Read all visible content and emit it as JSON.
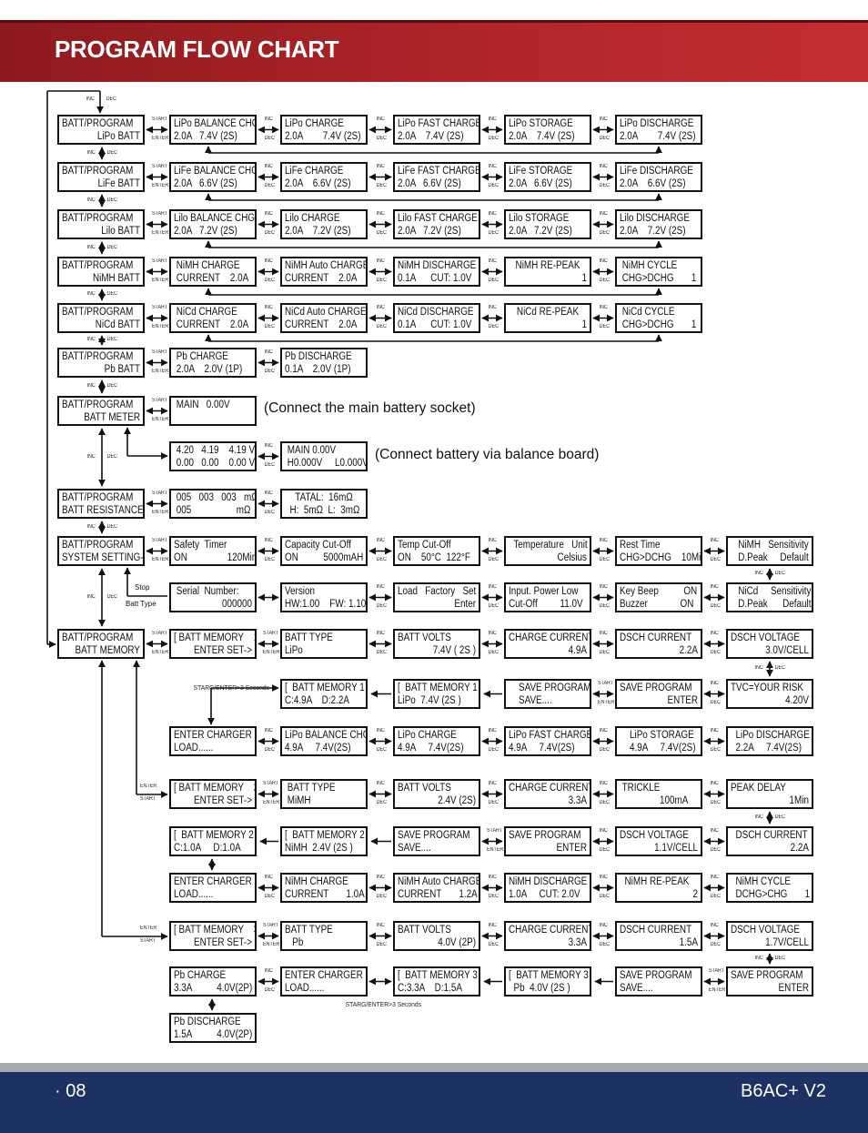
{
  "header": {
    "title": "PROGRAM FLOW CHART"
  },
  "footer": {
    "page": "· 08",
    "model": "B6AC+ V2"
  },
  "labels": {
    "inc": "INC",
    "dec": "DEC",
    "start": "START",
    "enter": "ENTER",
    "stop": "Stop",
    "batt_type": "Batt Type",
    "starg": "STARG/ENTER>3 Seconds"
  },
  "notes": {
    "main_socket": "(Connect the main battery socket)",
    "balance_board": "(Connect battery via balance board)"
  },
  "rows": [
    [
      {
        "l1": "BATT/PROGRAM",
        "l2": "LiPo BATT"
      },
      {
        "l1": "LiPo BALANCE CHG",
        "l2": "2.0A   7.4V (2S)"
      },
      {
        "l1": "LiPo CHARGE",
        "l2": "2.0A        7.4V (2S)"
      },
      {
        "l1": "LiPo FAST CHARGE",
        "l2": "2.0A    7.4V (2S)"
      },
      {
        "l1": "LiPo STORAGE",
        "l2": "2.0A    7.4V (2S)"
      },
      {
        "l1": "LiPo DISCHARGE",
        "l2": "2.0A        7.4V (2S)"
      }
    ],
    [
      {
        "l1": "BATT/PROGRAM",
        "l2": "LiFe BATT"
      },
      {
        "l1": "LiFe BALANCE CHG",
        "l2": "2.0A   6.6V (2S)"
      },
      {
        "l1": "LiFe CHARGE",
        "l2": "2.0A    6.6V (2S)"
      },
      {
        "l1": "LiFe FAST CHARGE",
        "l2": "2.0A   6.6V (2S)"
      },
      {
        "l1": "LiFe STORAGE",
        "l2": "2.0A   6.6V (2S)"
      },
      {
        "l1": "LiFe DISCHARGE",
        "l2": "2.0A    6.6V (2S)"
      }
    ],
    [
      {
        "l1": "BATT/PROGRAM",
        "l2": "Lilo BATT"
      },
      {
        "l1": "Lilo BALANCE CHG",
        "l2": "2.0A   7.2V (2S)"
      },
      {
        "l1": "Lilo CHARGE",
        "l2": "2.0A    7.2V (2S)"
      },
      {
        "l1": "Lilo FAST CHARGE",
        "l2": "2.0A   7.2V (2S)"
      },
      {
        "l1": "Lilo STORAGE",
        "l2": "2.0A   7.2V (2S)"
      },
      {
        "l1": "Lilo DISCHARGE",
        "l2": "2.0A    7.2V (2S)"
      }
    ],
    [
      {
        "l1": "BATT/PROGRAM",
        "l2": "NiMH BATT"
      },
      {
        "l1": " NiMH CHARGE",
        "l2": " CURRENT    2.0A"
      },
      {
        "l1": "NiMH Auto CHARGE",
        "l2": "CURRENT    2.0A"
      },
      {
        "l1": "NiMH DISCHARGE",
        "l2": "0.1A      CUT: 1.0V"
      },
      {
        "l1": "NiMH RE-PEAK",
        "l2": "1"
      },
      {
        "l1": " NiMH CYCLE",
        "l2": " CHG>DCHG       1"
      }
    ],
    [
      {
        "l1": "BATT/PROGRAM",
        "l2": "NiCd BATT"
      },
      {
        "l1": " NiCd CHARGE",
        "l2": " CURRENT    2.0A"
      },
      {
        "l1": "NiCd Auto CHARGE",
        "l2": "CURRENT    2.0A"
      },
      {
        "l1": "NiCd DISCHARGE",
        "l2": "0.1A      CUT: 1.0V"
      },
      {
        "l1": "NiCd RE-PEAK",
        "l2": "1"
      },
      {
        "l1": " NiCd CYCLE",
        "l2": " CHG>DCHG       1"
      }
    ],
    [
      {
        "l1": "BATT/PROGRAM",
        "l2": "Pb BATT"
      },
      {
        "l1": " Pb CHARGE",
        "l2": " 2.0A    2.0V (1P)"
      },
      {
        "l1": "Pb DISCHARGE",
        "l2": "0.1A    2.0V (1P)"
      }
    ],
    [
      {
        "l1": "BATT/PROGRAM",
        "l2": "BATT METER"
      },
      {
        "l1": " MAIN   0.00V",
        "l2": ""
      }
    ],
    [
      {
        "l1": " 4.20   4.19    4.19 V",
        "l2": " 0.00   0.00    0.00 V"
      },
      {
        "l1": " MAIN 0.00V",
        "l2": " H0.000V     L0.000V"
      }
    ],
    [
      {
        "l1": "BATT/PROGRAM",
        "l2": "BATT RESISTANCE"
      },
      {
        "l1": " 005   003   003   mΩ",
        "l2": " 005                  mΩ"
      },
      {
        "l1": "TATAL:  16mΩ",
        "l2": "  H:  5mΩ  L:  3mΩ"
      }
    ],
    [
      {
        "l1": "BATT/PROGRAM",
        "l2": "SYSTEM SETTING->"
      },
      {
        "l1": "Safety  Timer",
        "l2": "ON                120Min"
      },
      {
        "l1": "Capacity Cut-Off",
        "l2": "ON          5000mAH"
      },
      {
        "l1": "Temp Cut-Off",
        "l2": "ON    50°C  122°F"
      },
      {
        "l1": "  Temperature   Unit",
        "l2": "Celsius"
      },
      {
        "l1": "Rest Time",
        "l2": "CHG>DCHG    10Min"
      },
      {
        "l1": "   NiMH   Sensitivity",
        "l2": "   D.Peak     Default"
      }
    ],
    [
      {
        "l1": " Serial  Number:",
        "l2": "000000"
      },
      {
        "l1": "Version",
        "l2": "HW:1.00    FW: 1.10"
      },
      {
        "l1": "Load   Factory   Set",
        "l2": "Enter"
      },
      {
        "l1": "Input. Power Low",
        "l2": "Cut-Off         11.0V"
      },
      {
        "l1": "Key Beep          ON",
        "l2": "Buzzer             ON"
      },
      {
        "l1": "   NiCd     Sensitivity",
        "l2": "   D.Peak      Default"
      }
    ],
    [
      {
        "l1": "BATT/PROGRAM",
        "l2": "BATT MEMORY"
      },
      {
        "l1": "[ BATT MEMORY    1 ]",
        "l2": "ENTER SET->"
      },
      {
        "l1": "BATT TYPE",
        "l2": "LiPo"
      },
      {
        "l1": "BATT VOLTS",
        "l2": "7.4V ( 2S )"
      },
      {
        "l1": "CHARGE CURRENT",
        "l2": "4.9A"
      },
      {
        "l1": "DSCH CURRENT",
        "l2": "2.2A"
      },
      {
        "l1": "DSCH VOLTAGE",
        "l2": "3.0V/CELL"
      }
    ],
    [
      {
        "l1": "[  BATT MEMORY 1  ]",
        "l2": "C:4.9A    D:2.2A"
      },
      {
        "l1": "[  BATT MEMORY 1  ]",
        "l2": "LiPo  7.4V (2S )"
      },
      {
        "l1": "    SAVE PROGRAM",
        "l2": "    SAVE...."
      },
      {
        "l1": "SAVE PROGRAM",
        "l2": "ENTER"
      },
      {
        "l1": "TVC=YOUR RISK",
        "l2": "4.20V"
      }
    ],
    [
      {
        "l1": "ENTER CHARGER",
        "l2": "LOAD......"
      },
      {
        "l1": "LiPo BALANCE CHG",
        "l2": "4.9A     7.4V(2S)"
      },
      {
        "l1": "LiPo CHARGE",
        "l2": "4.9A     7.4V(2S)"
      },
      {
        "l1": "LiPo FAST CHARGE",
        "l2": "4.9A     7.4V(2S)"
      },
      {
        "l1": "    LiPo STORAGE",
        "l2": "    4.9A     7.4V(2S)"
      },
      {
        "l1": "  LiPo DISCHARGE",
        "l2": "  2.2A     7.4V(2S)"
      }
    ],
    [
      {
        "l1": "[ BATT MEMORY    2 ]",
        "l2": "ENTER SET->"
      },
      {
        "l1": " BATT TYPE",
        "l2": " MiMH"
      },
      {
        "l1": "BATT VOLTS",
        "l2": "2.4V (2S)"
      },
      {
        "l1": "CHARGE CURRENT",
        "l2": "3.3A"
      },
      {
        "l1": " TRICKLE",
        "l2": "                100mA"
      },
      {
        "l1": "PEAK DELAY",
        "l2": "1Min"
      }
    ],
    [
      {
        "l1": "[  BATT MEMORY 2  ]",
        "l2": "C:1.0A     D:1.0A"
      },
      {
        "l1": "[  BATT MEMORY 2  ]",
        "l2": "NiMH  2.4V (2S )"
      },
      {
        "l1": "SAVE PROGRAM",
        "l2": "SAVE...."
      },
      {
        "l1": "SAVE PROGRAM",
        "l2": "ENTER"
      },
      {
        "l1": "DSCH VOLTAGE",
        "l2": "1.1V/CELL"
      },
      {
        "l1": "  DSCH CURRENT",
        "l2": "2.2A"
      }
    ],
    [
      {
        "l1": "ENTER CHARGER",
        "l2": "LOAD......"
      },
      {
        "l1": "NiMH CHARGE",
        "l2": "CURRENT       1.0A"
      },
      {
        "l1": "NiMH Auto CHARGE",
        "l2": "CURRENT       1.2A"
      },
      {
        "l1": "NiMH DISCHARGE",
        "l2": "1.0A     CUT: 2.0V"
      },
      {
        "l1": "  NiMH RE-PEAK",
        "l2": "2"
      },
      {
        "l1": "  NiMH CYCLE",
        "l2": "  DCHG>CHG       1"
      }
    ],
    [
      {
        "l1": "[ BATT MEMORY    3 ]",
        "l2": "ENTER SET->"
      },
      {
        "l1": "BATT TYPE",
        "l2": "   Pb"
      },
      {
        "l1": "BATT VOLTS",
        "l2": "4.0V (2P)"
      },
      {
        "l1": "CHARGE CURRENT",
        "l2": "3.3A"
      },
      {
        "l1": "DSCH CURRENT",
        "l2": "1.5A"
      },
      {
        "l1": "DSCH VOLTAGE",
        "l2": "1.7V/CELL"
      }
    ],
    [
      {
        "l1": "Pb CHARGE",
        "l2": "3.3A          4.0V(2P)"
      },
      {
        "l1": "ENTER CHARGER",
        "l2": "LOAD......"
      },
      {
        "l1": "[  BATT MEMORY 3  ]",
        "l2": "C:3.3A    D:1.5A"
      },
      {
        "l1": "[  BATT MEMORY 3  ]",
        "l2": "  Pb  4.0V (2S )"
      },
      {
        "l1": "SAVE PROGRAM",
        "l2": "SAVE...."
      },
      {
        "l1": "SAVE PROGRAM",
        "l2": "ENTER"
      }
    ],
    [
      {
        "l1": "Pb DISCHARGE",
        "l2": "1.5A          4.0V(2P)"
      }
    ]
  ]
}
